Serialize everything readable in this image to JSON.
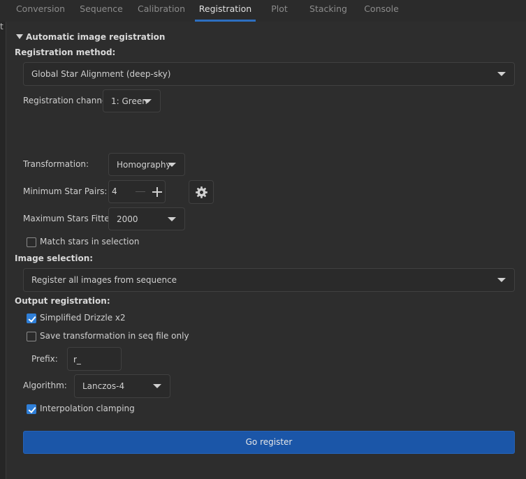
{
  "tabs": [
    "Conversion",
    "Sequence",
    "Calibration",
    "Registration",
    "Plot",
    "Stacking",
    "Console"
  ],
  "edge_text": "t",
  "section_title": "Automatic image registration",
  "registration_method": {
    "label": "Registration method:",
    "value": "Global Star Alignment (deep-sky)"
  },
  "channel": {
    "label": "Registration channel:",
    "value": "1: Green"
  },
  "transformation": {
    "label": "Transformation:",
    "value": "Homography"
  },
  "min_pairs": {
    "label": "Minimum Star Pairs:",
    "value": "4"
  },
  "max_stars": {
    "label": "Maximum Stars Fitted:",
    "value": "2000"
  },
  "match_selection": {
    "label": "Match stars in selection",
    "checked": false
  },
  "image_selection": {
    "label": "Image selection:",
    "value": "Register all images from sequence"
  },
  "output": {
    "label": "Output registration:",
    "drizzle": {
      "label": "Simplified Drizzle x2",
      "checked": true
    },
    "save_transform": {
      "label": "Save transformation in seq file only",
      "checked": false
    },
    "prefix": {
      "label": "Prefix:",
      "value": "r_"
    },
    "algorithm": {
      "label": "Algorithm:",
      "value": "Lanczos-4"
    },
    "clamping": {
      "label": "Interpolation clamping",
      "checked": true
    }
  },
  "go_button": "Go register",
  "colors": {
    "accent": "#2f7fd8",
    "button": "#1b56a8",
    "tab_underline": "#2d6fc0"
  }
}
